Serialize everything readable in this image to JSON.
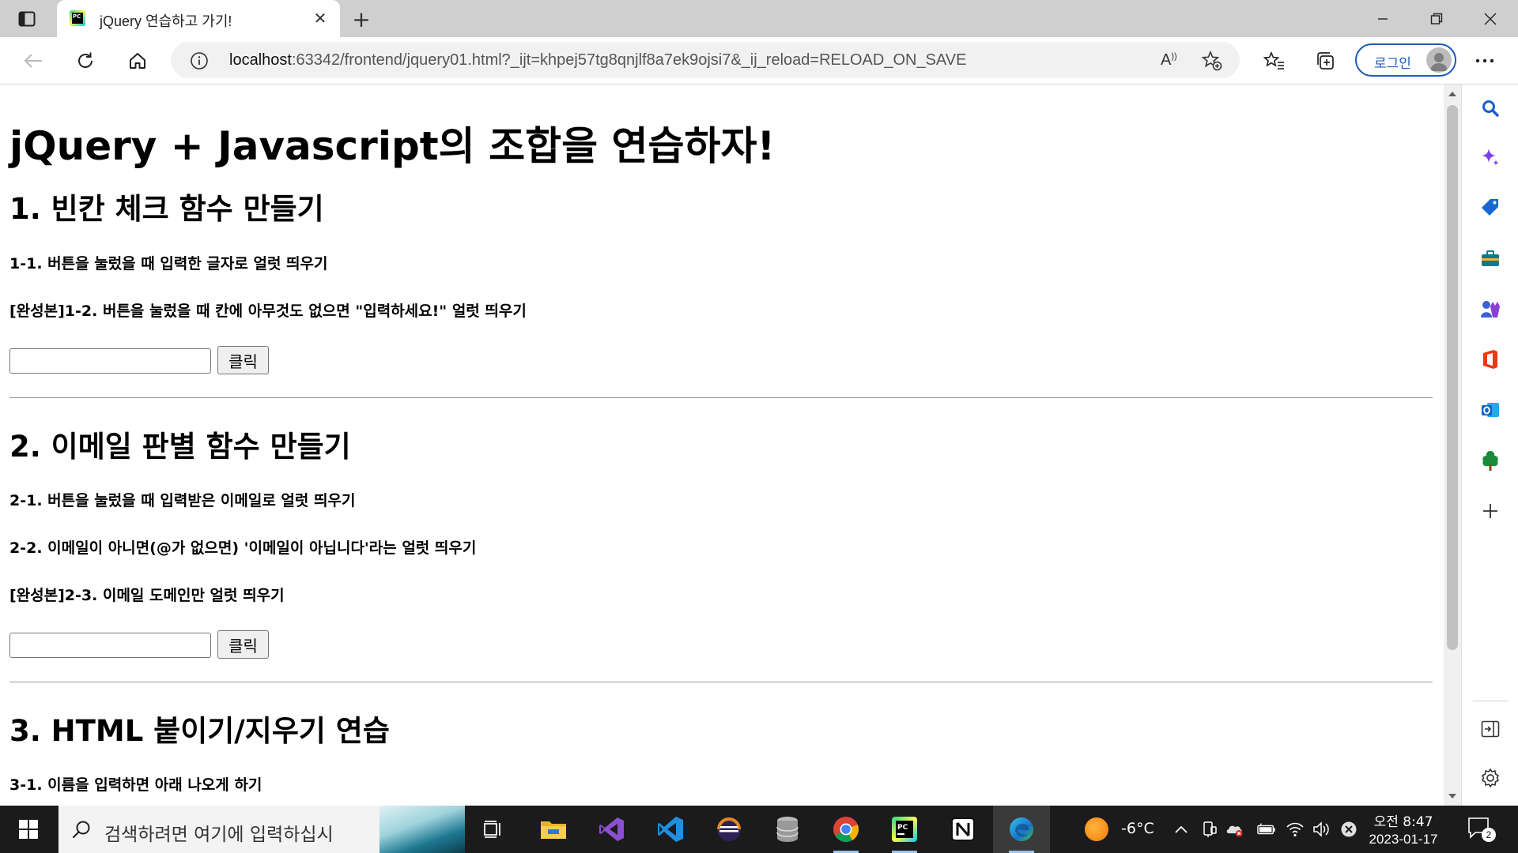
{
  "browser": {
    "tab": {
      "title": "jQuery 연습하고 가기!",
      "favicon_text": "PC"
    },
    "address": {
      "host": "localhost",
      "rest": ":63342/frontend/jquery01.html?_ijt=khpej57tg8qnjlf8a7ek9ojsi7&_ij_reload=RELOAD_ON_SAVE"
    },
    "login_label": "로그인"
  },
  "page": {
    "h1": "jQuery + Javascript의 조합을 연습하자!",
    "section1": {
      "title": "1. 빈칸 체크 함수 만들기",
      "items": [
        "1-1. 버튼을 눌렀을 때 입력한 글자로 얼럿 띄우기",
        "[완성본]1-2. 버튼을 눌렀을 때 칸에 아무것도 없으면 \"입력하세요!\" 얼럿 띄우기"
      ],
      "input_value": "",
      "button_label": "클릭"
    },
    "section2": {
      "title": "2. 이메일 판별 함수 만들기",
      "items": [
        "2-1. 버튼을 눌렀을 때 입력받은 이메일로 얼럿 띄우기",
        "2-2. 이메일이 아니면(@가 없으면) '이메일이 아닙니다'라는 얼럿 띄우기",
        "[완성본]2-3. 이메일 도메인만 얼럿 띄우기"
      ],
      "input_value": "",
      "button_label": "클릭"
    },
    "section3": {
      "title": "3. HTML 붙이기/지우기 연습",
      "items": [
        "3-1. 이름을 입력하면 아래 나오게 하기"
      ]
    }
  },
  "taskbar": {
    "search_placeholder": "검색하려면 여기에 입력하십시",
    "weather_temp": "-6°C",
    "clock_time": "오전 8:47",
    "clock_date": "2023-01-17",
    "notification_count": "2"
  }
}
